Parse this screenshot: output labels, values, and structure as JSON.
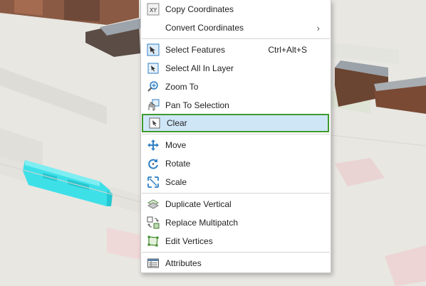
{
  "menu": {
    "items": [
      {
        "label": "Copy Coordinates",
        "icon": "copy-coordinates-icon",
        "shortcut": "",
        "submenu": false
      },
      {
        "label": "Convert Coordinates",
        "icon": "",
        "shortcut": "",
        "submenu": true
      },
      {
        "label": "Select Features",
        "icon": "select-features-icon",
        "shortcut": "Ctrl+Alt+S",
        "submenu": false
      },
      {
        "label": "Select All In Layer",
        "icon": "select-all-layer-icon",
        "shortcut": "",
        "submenu": false
      },
      {
        "label": "Zoom To",
        "icon": "zoom-to-icon",
        "shortcut": "",
        "submenu": false
      },
      {
        "label": "Pan To Selection",
        "icon": "pan-to-selection-icon",
        "shortcut": "",
        "submenu": false
      },
      {
        "label": "Clear",
        "icon": "clear-selection-icon",
        "shortcut": "",
        "submenu": false,
        "selected": true
      },
      {
        "label": "Move",
        "icon": "move-icon",
        "shortcut": "",
        "submenu": false
      },
      {
        "label": "Rotate",
        "icon": "rotate-icon",
        "shortcut": "",
        "submenu": false
      },
      {
        "label": "Scale",
        "icon": "scale-icon",
        "shortcut": "",
        "submenu": false
      },
      {
        "label": "Duplicate Vertical",
        "icon": "duplicate-vertical-icon",
        "shortcut": "",
        "submenu": false
      },
      {
        "label": "Replace Multipatch",
        "icon": "replace-multipatch-icon",
        "shortcut": "",
        "submenu": false
      },
      {
        "label": "Edit Vertices",
        "icon": "edit-vertices-icon",
        "shortcut": "",
        "submenu": false
      },
      {
        "label": "Attributes",
        "icon": "attributes-icon",
        "shortcut": "",
        "submenu": false
      }
    ],
    "submenu_arrow": "›",
    "copy_icon_text": "XY"
  },
  "colors": {
    "selected_bg": "#cfe6f7",
    "selected_border": "#3f9a2c",
    "selected_feature": "#3ee0e8",
    "icon_blue": "#2f7fc4"
  }
}
